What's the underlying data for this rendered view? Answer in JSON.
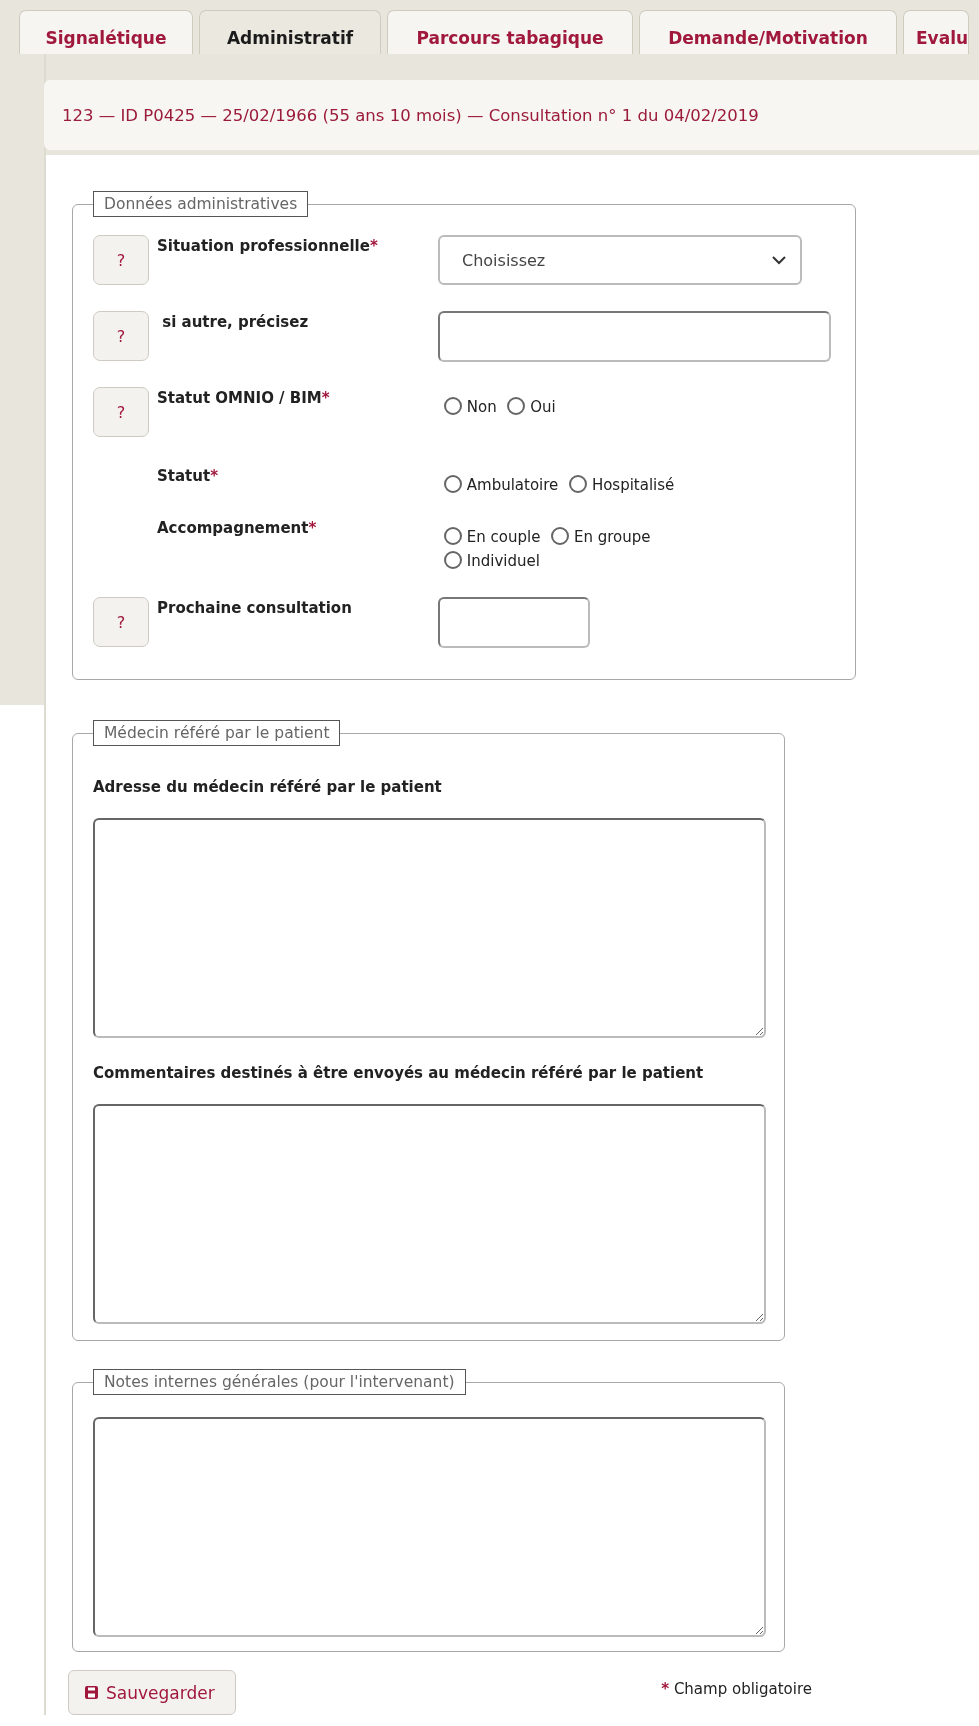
{
  "tabs": [
    {
      "label": "Signalétique",
      "selected": false
    },
    {
      "label": "Administratif",
      "selected": true
    },
    {
      "label": "Parcours tabagique",
      "selected": false
    },
    {
      "label": "Demande/Motivation",
      "selected": false
    },
    {
      "label": "Evalu",
      "selected": false
    }
  ],
  "header": "123 — ID P0425 — 25/02/1966 (55 ans 10 mois) — Consultation n° 1 du 04/02/2019",
  "admin": {
    "legend": "Données administratives",
    "rows": [
      {
        "kind": "select",
        "help": "?",
        "label": "Situation professionnelle",
        "mark": "*",
        "value": "Choisissez"
      },
      {
        "kind": "text",
        "help": "?",
        "label": " si autre, précisez"
      },
      {
        "kind": "radio",
        "help": "?",
        "label": "Statut OMNIO / BIM",
        "mark": "*",
        "options": [
          {
            "label": "Non",
            "selected": false
          },
          {
            "label": "Oui",
            "selected": false
          }
        ]
      },
      {
        "kind": "radio",
        "label": "Statut",
        "mark": "*",
        "options": [
          {
            "label": "Ambulatoire",
            "selected": false
          },
          {
            "label": "Hospitalisé",
            "selected": false
          }
        ]
      },
      {
        "kind": "radio",
        "label": "Accompagnement",
        "mark": "*",
        "options": [
          {
            "label": "En couple",
            "selected": false
          },
          {
            "label": "En groupe",
            "selected": false
          },
          {
            "label": "Individuel",
            "selected": false
          }
        ]
      },
      {
        "kind": "short-text",
        "help": "?",
        "label": "Prochaine consultation"
      }
    ]
  },
  "doctor": {
    "legend": "Médecin référé par le patient",
    "fields": [
      {
        "label": "Adresse du médecin référé par le patient"
      },
      {
        "label": "Commentaires destinés à être envoyés au médecin référé par le patient"
      }
    ]
  },
  "notes": {
    "legend": "Notes internes générales (pour l'intervenant)"
  },
  "save_button": "Sauvegarder",
  "footnote": {
    "mark": "*",
    "text": "Champ obligatoire"
  }
}
